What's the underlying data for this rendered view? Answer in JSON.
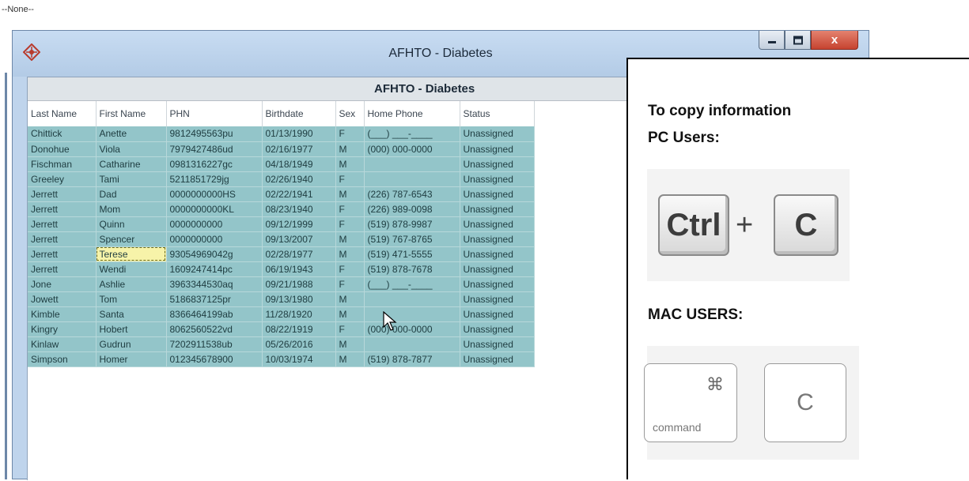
{
  "top_label": "--None--",
  "window": {
    "title": "AFHTO - Diabetes",
    "controls": {
      "minimize_icon": "minimize-icon",
      "maximize_icon": "maximize-icon",
      "close_label": "x"
    }
  },
  "grid": {
    "title": "AFHTO - Diabetes",
    "columns": [
      "Last Name",
      "First Name",
      "PHN",
      "Birthdate",
      "Sex",
      "Home Phone",
      "Status"
    ],
    "rows": [
      [
        "Chittick",
        "Anette",
        "9812495563pu",
        "01/13/1990",
        "F",
        "(___) ___-____",
        "Unassigned"
      ],
      [
        "Donohue",
        "Viola",
        "7979427486ud",
        "02/16/1977",
        "M",
        "(000) 000-0000",
        "Unassigned"
      ],
      [
        "Fischman",
        "Catharine",
        "0981316227gc",
        "04/18/1949",
        "M",
        "",
        "Unassigned"
      ],
      [
        "Greeley",
        "Tami",
        "5211851729jg",
        "02/26/1940",
        "F",
        "",
        "Unassigned"
      ],
      [
        "Jerrett",
        "Dad",
        "0000000000HS",
        "02/22/1941",
        "M",
        "(226) 787-6543",
        "Unassigned"
      ],
      [
        "Jerrett",
        "Mom",
        "0000000000KL",
        "08/23/1940",
        "F",
        "(226) 989-0098",
        "Unassigned"
      ],
      [
        "Jerrett",
        "Quinn",
        "0000000000",
        "09/12/1999",
        "F",
        "(519) 878-9987",
        "Unassigned"
      ],
      [
        "Jerrett",
        "Spencer",
        "0000000000",
        "09/13/2007",
        "M",
        "(519) 767-8765",
        "Unassigned"
      ],
      [
        "Jerrett",
        "Terese",
        "93054969042g",
        "02/28/1977",
        "M",
        "(519) 471-5555",
        "Unassigned"
      ],
      [
        "Jerrett",
        "Wendi",
        "1609247414pc",
        "06/19/1943",
        "F",
        "(519) 878-7678",
        "Unassigned"
      ],
      [
        "Jone",
        "Ashlie",
        "3963344530aq",
        "09/21/1988",
        "F",
        "(___) ___-____",
        "Unassigned"
      ],
      [
        "Jowett",
        "Tom",
        "5186837125pr",
        "09/13/1980",
        "M",
        "",
        "Unassigned"
      ],
      [
        "Kimble",
        "Santa",
        "8366464199ab",
        "11/28/1920",
        "M",
        "",
        "Unassigned"
      ],
      [
        "Kingry",
        "Hobert",
        "8062560522vd",
        "08/22/1919",
        "F",
        "(000) 000-0000",
        "Unassigned"
      ],
      [
        "Kinlaw",
        "Gudrun",
        "7202911538ub",
        "05/26/2016",
        "M",
        "",
        "Unassigned"
      ],
      [
        "Simpson",
        "Homer",
        "012345678900",
        "10/03/1974",
        "M",
        "(519) 878-7877",
        "Unassigned"
      ]
    ],
    "selected_cell": {
      "row": 8,
      "col": 1
    }
  },
  "overlay": {
    "title": "To copy information",
    "pc_label": "PC Users:",
    "pc_keys": {
      "key1": "Ctrl",
      "plus": "+",
      "key2": "C"
    },
    "mac_label": "MAC USERS:",
    "mac_keys": {
      "cmd_symbol": "⌘",
      "cmd_word": "command",
      "key2": "C"
    }
  },
  "colors": {
    "row_fill": "#93c5c9",
    "selected_fill": "#f7f3a9",
    "titlebar": "#c8dcf2",
    "close_button": "#c64330"
  }
}
